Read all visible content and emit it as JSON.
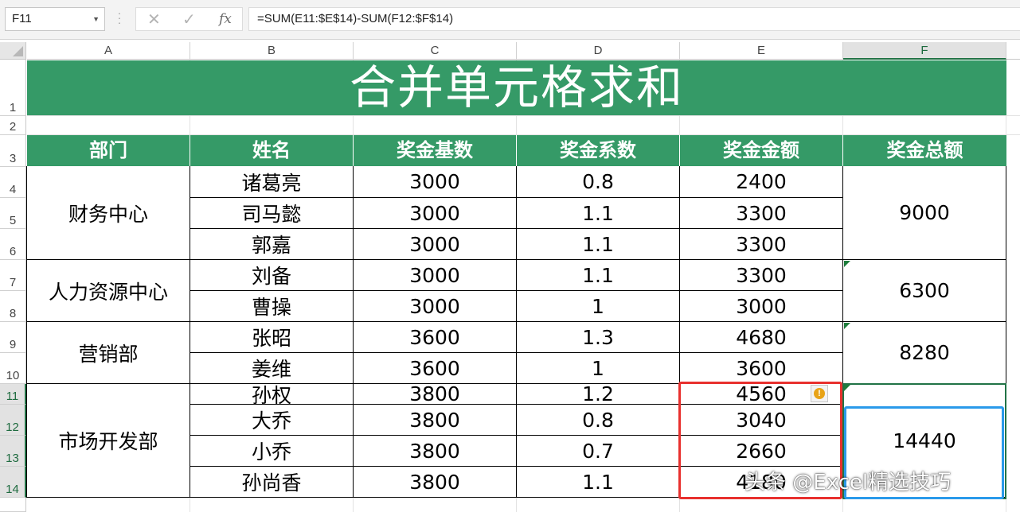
{
  "formula_bar": {
    "name_box": "F11",
    "cancel_icon": "✕",
    "enter_icon": "✓",
    "fx_label": "fx",
    "formula": "=SUM(E11:$E$14)-SUM(F12:$F$14)"
  },
  "columns": [
    "A",
    "B",
    "C",
    "D",
    "E",
    "F"
  ],
  "selected_column": "F",
  "rows": [
    "1",
    "2",
    "3",
    "4",
    "5",
    "6",
    "7",
    "8",
    "9",
    "10",
    "11",
    "12",
    "13",
    "14"
  ],
  "title": "合并单元格求和",
  "headers": [
    "部门",
    "姓名",
    "奖金基数",
    "奖金系数",
    "奖金金额",
    "奖金总额"
  ],
  "departments": [
    "财务中心",
    "人力资源中心",
    "营销部",
    "市场开发部"
  ],
  "records": [
    {
      "name": "诸葛亮",
      "base": "3000",
      "coef": "0.8",
      "amount": "2400"
    },
    {
      "name": "司马懿",
      "base": "3000",
      "coef": "1.1",
      "amount": "3300"
    },
    {
      "name": "郭嘉",
      "base": "3000",
      "coef": "1.1",
      "amount": "3300"
    },
    {
      "name": "刘备",
      "base": "3000",
      "coef": "1.1",
      "amount": "3300"
    },
    {
      "name": "曹操",
      "base": "3000",
      "coef": "1",
      "amount": "3000"
    },
    {
      "name": "张昭",
      "base": "3600",
      "coef": "1.3",
      "amount": "4680"
    },
    {
      "name": "姜维",
      "base": "3600",
      "coef": "1",
      "amount": "3600"
    },
    {
      "name": "孙权",
      "base": "3800",
      "coef": "1.2",
      "amount": "4560"
    },
    {
      "name": "大乔",
      "base": "3800",
      "coef": "0.8",
      "amount": "3040"
    },
    {
      "name": "小乔",
      "base": "3800",
      "coef": "0.7",
      "amount": "2660"
    },
    {
      "name": "孙尚香",
      "base": "3800",
      "coef": "1.1",
      "amount": "4180"
    }
  ],
  "totals": [
    "9000",
    "6300",
    "8280",
    "14440"
  ],
  "watermark": "头条 @Excel精选技巧",
  "colors": {
    "header_green": "#359a67",
    "selection_green": "#217346",
    "red_highlight": "#e8302e",
    "blue_highlight": "#2a9aea"
  }
}
